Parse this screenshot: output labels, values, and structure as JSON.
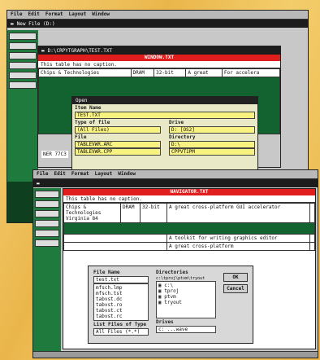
{
  "menu": [
    "File",
    "Edit",
    "Format",
    "Layout",
    "Window"
  ],
  "win_back": {
    "title": "New File (D:)"
  },
  "win_mid": {
    "title": "D:\\CRPYTGRAPH\\TEST.TXT",
    "red_label": "WINDOW.TXT"
  },
  "caption": "This table has no caption.",
  "table_mid": {
    "rows": [
      [
        "Chips & Technologies",
        "DRAM",
        "32-bit",
        "A great",
        "For accelera"
      ],
      [
        "",
        "",
        "",
        "",
        ""
      ]
    ],
    "left_fragment": "NER 77C3"
  },
  "open_dialog": {
    "title": "Open",
    "name_label": "Item Name",
    "name_value": "TEST.TXT",
    "type_label": "Type of file",
    "type_value": "(All Files)",
    "drive_label": "Drive",
    "drive_value": "D: [OS2]",
    "files_label": "File",
    "dirs_label": "Directory",
    "files": [
      "TABLEVWR.ARC",
      "TABLEVWR.CPP"
    ],
    "dirs": [
      "D:\\",
      "CPPVT1PM"
    ]
  },
  "win_front": {
    "red_label": "NAVIGATOR.TXT",
    "rows": [
      [
        "Chips & Technologies Virginia 84",
        "DRAM",
        "32-bit",
        "A great cross-platform GUI accelerator",
        ""
      ],
      [
        "",
        "",
        "",
        "A toolkit for writing graphics editor",
        ""
      ],
      [
        "",
        "",
        "",
        "A great cross-platform",
        ""
      ]
    ]
  },
  "save_dialog": {
    "files_label": "File Name",
    "name_value": "test.txt",
    "files": [
      "mfsch.lmp",
      "mfsch.tst",
      "tabvst.dc",
      "tabvst.ro",
      "tabvst.ct",
      "tabvst.rc",
      "tabvst.ucs"
    ],
    "dirs_label": "Directories",
    "dirs_path": "c:\\tproj\\ptvm\\tryout",
    "dirs": [
      "c:\\",
      "tproj",
      "ptvm",
      "tryout"
    ],
    "type_label": "List Files of Type",
    "type_value": "All Files (*.*)",
    "drive_label": "Drives",
    "drive_value": "c: ...wave",
    "ok": "OK",
    "cancel": "Cancel"
  }
}
